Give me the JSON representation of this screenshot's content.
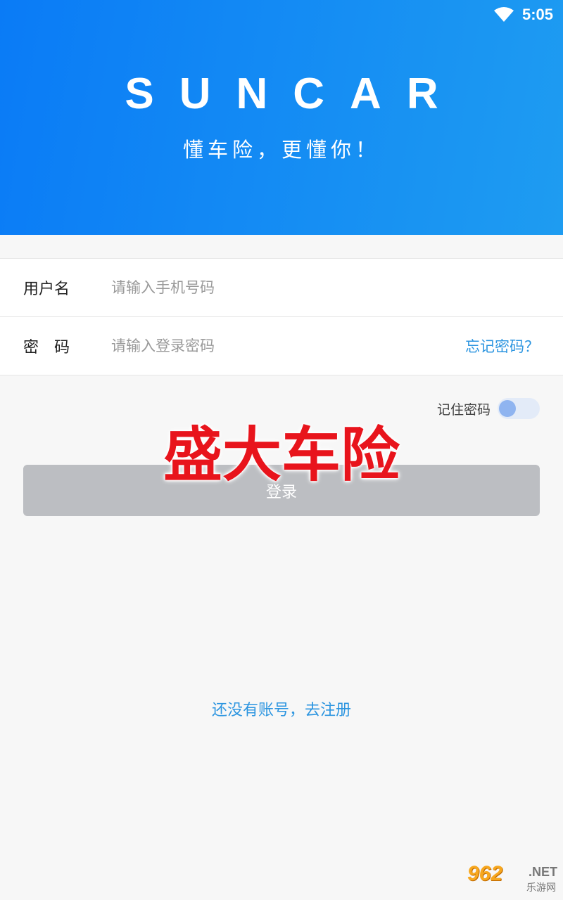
{
  "status_bar": {
    "time": "5:05",
    "wifi_icon": "wifi-icon"
  },
  "header": {
    "brand": "SUNCAR",
    "slogan": "懂车险，更懂你！"
  },
  "form": {
    "username_label": "用户名",
    "username_placeholder": "请输入手机号码",
    "password_label": "密　码",
    "password_placeholder": "请输入登录密码",
    "forgot_link": "忘记密码？"
  },
  "remember": {
    "label": "记住密码",
    "on": false
  },
  "login_button": "登录",
  "overlay_title": "盛大车险",
  "register_link": "还没有账号，去注册",
  "watermark": {
    "main": "962",
    "net": ".NET",
    "sub": "乐游网"
  },
  "colors": {
    "header_start": "#0a7bf6",
    "header_end": "#1e9cf1",
    "link": "#2c95e0",
    "overlay": "#e8141c"
  }
}
